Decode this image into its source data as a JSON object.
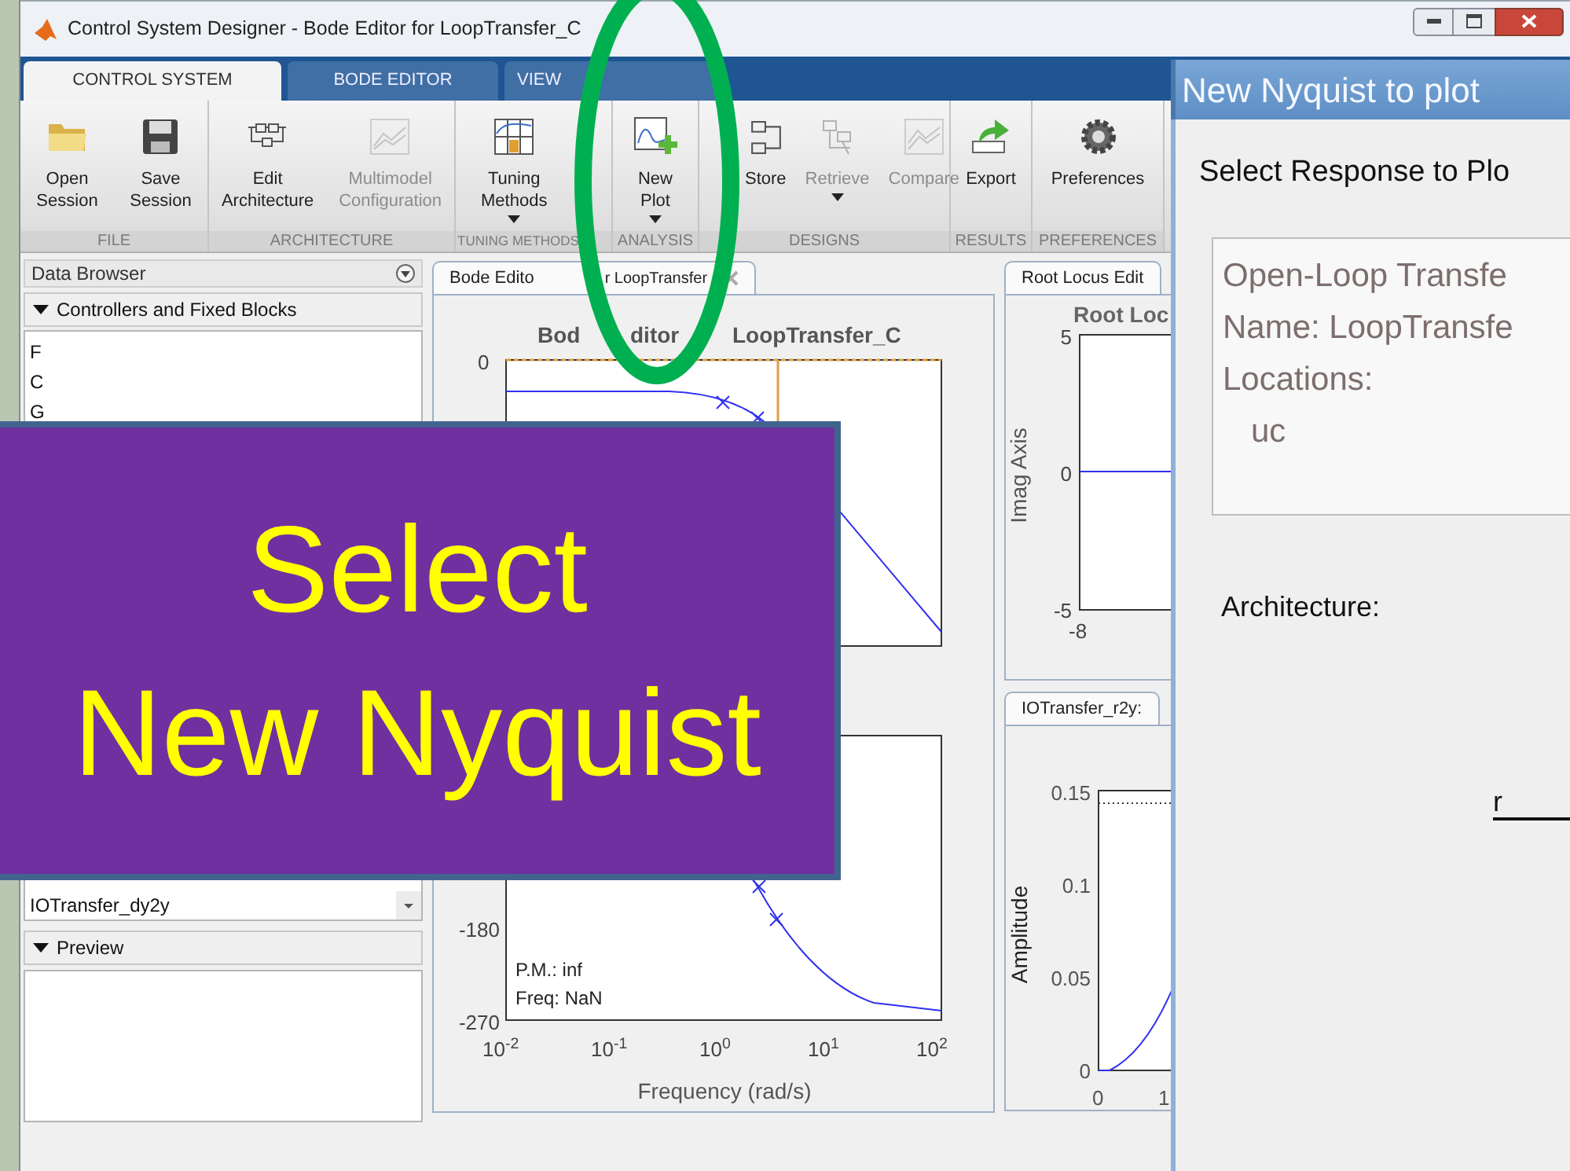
{
  "window": {
    "title": "Control System Designer - Bode Editor for LoopTransfer_C"
  },
  "tabs": [
    {
      "label": "CONTROL SYSTEM",
      "selected": true
    },
    {
      "label": "BODE EDITOR",
      "selected": false
    },
    {
      "label": "VIEW",
      "selected": false
    }
  ],
  "toolstrip": [
    {
      "section": "FILE",
      "buttons": [
        {
          "lines": [
            "Open",
            "Session"
          ],
          "disabled": false,
          "dropdown": false
        },
        {
          "lines": [
            "Save",
            "Session"
          ],
          "disabled": false,
          "dropdown": false
        }
      ]
    },
    {
      "section": "ARCHITECTURE",
      "buttons": [
        {
          "lines": [
            "Edit",
            "Architecture"
          ],
          "disabled": false,
          "dropdown": false
        },
        {
          "lines": [
            "Multimodel",
            "Configuration"
          ],
          "disabled": true,
          "dropdown": false
        }
      ]
    },
    {
      "section": "TUNING METHODS",
      "buttons": [
        {
          "lines": [
            "Tuning",
            "Methods"
          ],
          "disabled": false,
          "dropdown": true
        }
      ]
    },
    {
      "section": "ANALYSIS",
      "buttons": [
        {
          "lines": [
            "New",
            "Plot"
          ],
          "disabled": false,
          "dropdown": true
        }
      ]
    },
    {
      "section": "DESIGNS",
      "buttons": [
        {
          "lines": [
            "Store"
          ],
          "disabled": false,
          "dropdown": false
        },
        {
          "lines": [
            "Retrieve"
          ],
          "disabled": true,
          "dropdown": true
        },
        {
          "lines": [
            "Compare"
          ],
          "disabled": true,
          "dropdown": false
        }
      ]
    },
    {
      "section": "RESULTS",
      "buttons": [
        {
          "lines": [
            "Export"
          ],
          "disabled": false,
          "dropdown": false
        }
      ]
    },
    {
      "section": "PREFERENCES",
      "buttons": [
        {
          "lines": [
            "Preferences"
          ],
          "disabled": false,
          "dropdown": false
        }
      ]
    }
  ],
  "data_browser": {
    "title": "Data Browser",
    "controllers": {
      "title": "Controllers and Fixed Blocks",
      "expanded": true,
      "items": [
        "F",
        "C",
        "G"
      ]
    },
    "responses": {
      "items": [
        "IOTransfer_dy2y"
      ]
    },
    "preview": {
      "title": "Preview",
      "expanded": true
    }
  },
  "bode": {
    "tab_parts": [
      "Bode Edito",
      "r LoopTransfer"
    ],
    "title_parts": [
      "Bod",
      "ditor",
      "LoopTransfer_C"
    ],
    "magnitude_ticks": [
      "0"
    ],
    "phase_ticks": [
      "-180",
      "-270"
    ],
    "x_ticks": [
      "10$^{-2}$",
      "10$^{-1}$",
      "10$^{0}$",
      "10$^{1}$",
      "10$^{2}$"
    ],
    "xlabel": "Frequency (rad/s)",
    "readouts": [
      "P.M.: inf",
      "Freq: NaN"
    ]
  },
  "root_locus": {
    "tab": "Root Locus Edit",
    "title": "Root Loc",
    "y_ticks": [
      "5",
      "0",
      "-5"
    ],
    "x_ticks": [
      "-8"
    ],
    "ylabel": "Imag Axis"
  },
  "step": {
    "tab": "IOTransfer_r2y:",
    "y_ticks": [
      "0.15",
      "0.1",
      "0.05",
      "0"
    ],
    "x_ticks": [
      "0",
      "1"
    ],
    "ylabel": "Amplitude"
  },
  "dialog": {
    "title": "New Nyquist to plot",
    "heading": "Select Response to Plo",
    "details": [
      "Open-Loop Transfe",
      "Name: LoopTransfe",
      "Locations:",
      "uc"
    ],
    "architecture_label": "Architecture:",
    "signal": "r"
  },
  "callout": {
    "lines": [
      "Select",
      "New Nyquist"
    ]
  }
}
